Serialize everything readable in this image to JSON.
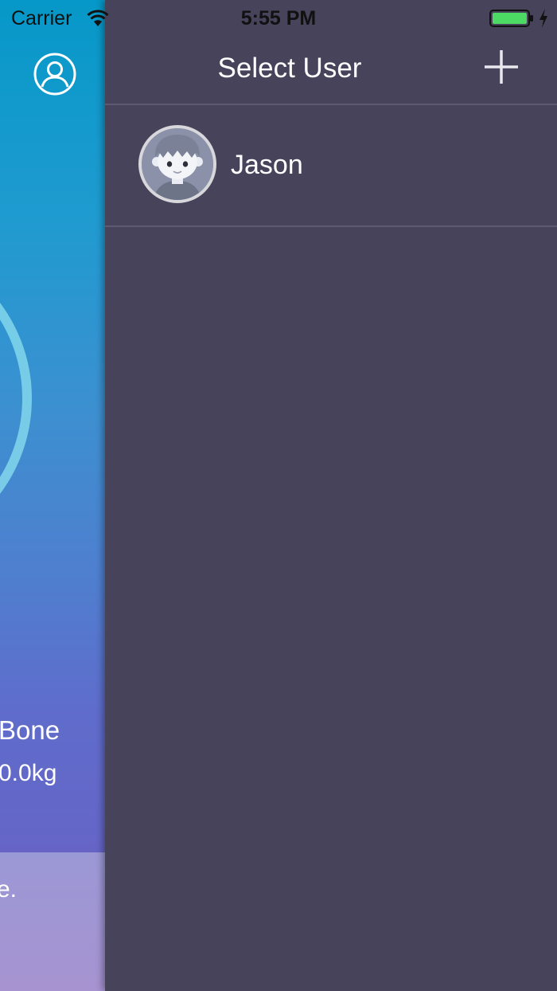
{
  "status_bar": {
    "carrier": "Carrier",
    "time": "5:55 PM",
    "battery_color": "#4cd964"
  },
  "background_screen": {
    "metric_label": "Bone",
    "metric_value": "0.0kg",
    "tip_text": "e.",
    "icons": [
      "user-profile-icon"
    ]
  },
  "drawer": {
    "title": "Select User",
    "add_icon": "plus-icon",
    "users": [
      {
        "name": "Jason",
        "avatar": "boy-avatar"
      }
    ]
  },
  "colors": {
    "drawer_bg": "#46435a",
    "divider": "#5d5a70",
    "gradient_top": "#0698c8",
    "gradient_bottom": "#6663c4"
  }
}
